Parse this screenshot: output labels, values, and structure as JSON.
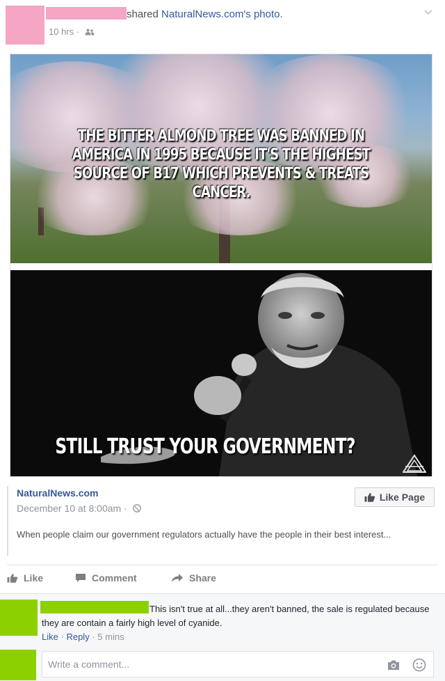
{
  "post": {
    "header_action": "shared",
    "page_link": "NaturalNews.com's",
    "object": "photo.",
    "time": "10 hrs",
    "separator": "·"
  },
  "photo": {
    "top_caption": "THE BITTER ALMOND TREE WAS BANNED IN AMERICA IN 1995 BECAUSE IT'S THE HIGHEST SOURCE OF B17 WHICH PREVENTS & TREATS CANCER.",
    "bottom_caption": "STILL TRUST YOUR GOVERNMENT?"
  },
  "link": {
    "source": "NaturalNews.com",
    "date": "December 10 at 8:00am",
    "separator": "·",
    "like_page": "Like Page",
    "description": "When people claim our government regulators actually have the people in their best interest..."
  },
  "actions": {
    "like": "Like",
    "comment": "Comment",
    "share": "Share"
  },
  "comment": {
    "text": "This isn't true at all...they aren't banned, the sale is regulated because they are contain a fairly high level of cyanide.",
    "like": "Like",
    "reply": "Reply",
    "time": "5 mins",
    "separator": "·"
  },
  "composer": {
    "placeholder": "Write a comment..."
  },
  "icons": {
    "audience": "friends-icon",
    "globe": "globe-icon",
    "menu": "chevron-down-icon",
    "like": "thumbs-up-icon",
    "comment": "speech-bubble-icon",
    "share": "share-arrow-icon",
    "camera": "camera-icon",
    "emoji": "smiley-icon"
  },
  "colors": {
    "link_blue": "#365899",
    "redaction_pink": "#f4a6c4",
    "redaction_green": "#8dd000",
    "meta_gray": "#90949c"
  }
}
